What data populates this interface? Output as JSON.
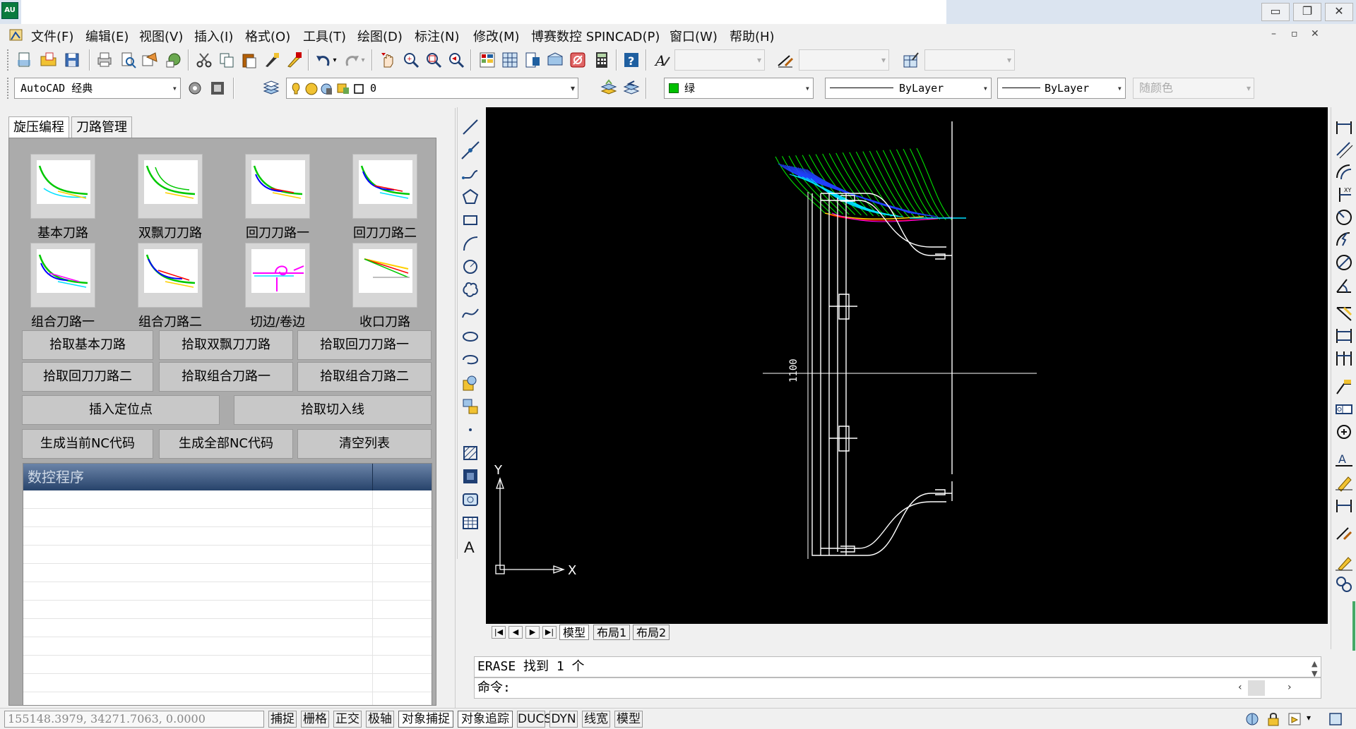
{
  "window": {
    "app_icon_text": "AU",
    "min_btn": "▭",
    "restore_btn": "❐",
    "close_btn": "✕"
  },
  "menu": {
    "items": [
      "文件(F)",
      "编辑(E)",
      "视图(V)",
      "插入(I)",
      "格式(O)",
      "工具(T)",
      "绘图(D)",
      "标注(N)",
      "修改(M)",
      "博赛数控 SPINCAD(P)",
      "窗口(W)",
      "帮助(H)"
    ],
    "mdi_min": "–",
    "mdi_restore": "▫",
    "mdi_close": "✕"
  },
  "toolbar2": {
    "workspace": "AutoCAD 经典",
    "layer_value": "0",
    "color_value": "绿",
    "color_hex": "#00c000",
    "linetype_value": "ByLayer",
    "lineweight_value": "ByLayer",
    "plotstyle_value": "随颜色"
  },
  "panel": {
    "tabs": [
      "旋压编程",
      "刀路管理"
    ],
    "thumbnails": [
      "基本刀路",
      "双飘刀刀路",
      "回刀刀路一",
      "回刀刀路二",
      "组合刀路一",
      "组合刀路二",
      "切边/卷边",
      "收口刀路"
    ],
    "buttons_row1": [
      "拾取基本刀路",
      "拾取双飘刀刀路",
      "拾取回刀刀路一"
    ],
    "buttons_row2": [
      "拾取回刀刀路二",
      "拾取组合刀路一",
      "拾取组合刀路二"
    ],
    "buttons_row3": [
      "插入定位点",
      "拾取切入线"
    ],
    "buttons_row4": [
      "生成当前NC代码",
      "生成全部NC代码",
      "清空列表"
    ],
    "list_header": "数控程序"
  },
  "canvas": {
    "dimension_text": "1100",
    "axis_y": "Y",
    "axis_x": "X"
  },
  "layout_tabs": [
    "模型",
    "布局1",
    "布局2"
  ],
  "command": {
    "history": "ERASE 找到 1 个",
    "prompt": "命令:"
  },
  "status": {
    "coords": "155148.3979, 34271.7063, 0.0000",
    "toggles": [
      "捕捉",
      "栅格",
      "正交",
      "极轴",
      "对象捕捉",
      "对象追踪",
      "DUCS",
      "DYN",
      "线宽",
      "模型"
    ]
  }
}
